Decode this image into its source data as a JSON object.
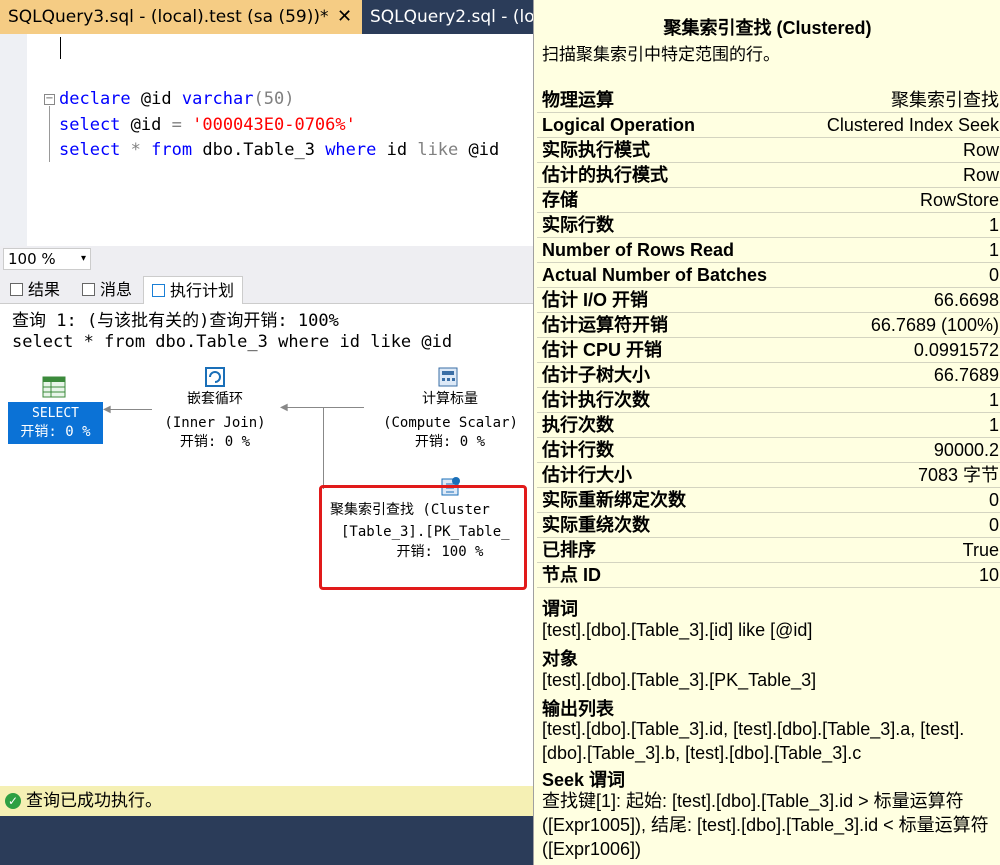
{
  "tabs": {
    "active": "SQLQuery3.sql - (local).test (sa (59))*",
    "active_close": "✕",
    "inactive": "SQLQuery2.sql - (lo"
  },
  "editor": {
    "fold_symbol": "−",
    "line1": {
      "kw1": "declare",
      "text1": " @id ",
      "kw2": "varchar",
      "text2": "(50)"
    },
    "line2": {
      "kw1": "select",
      "text1": " @id ",
      "op1": "=",
      "text2": " ",
      "str": "'000043E0-0706%'"
    },
    "line3": {
      "kw1": "select",
      "text1": " ",
      "op1": "*",
      "text2": " ",
      "kw2": "from",
      "text3": " dbo.Table_3 ",
      "kw3": "where",
      "text4": " id ",
      "op2": "like",
      "text5": " @id"
    }
  },
  "zoom": {
    "value": "100 %",
    "arrow": "▾"
  },
  "result_tabs": {
    "results": "结果",
    "messages": "消息",
    "plan": "执行计划"
  },
  "plan": {
    "query_header": "查询 1: (与该批有关的)查询开销: 100%",
    "query_sql": "select * from dbo.Table_3 where id like @id",
    "nodes": {
      "select": {
        "name": "SELECT",
        "cost": "开销: 0 %"
      },
      "nested_loops": {
        "name": "嵌套循环",
        "sub": "(Inner Join)",
        "cost": "开销: 0 %"
      },
      "compute_scalar": {
        "name": "计算标量",
        "sub": "(Compute Scalar)",
        "cost": "开销: 0 %"
      },
      "clustered_seek": {
        "name": "聚集索引查找 (Cluster",
        "sub": "[Table_3].[PK_Table_",
        "cost": "开销: 100 %"
      }
    }
  },
  "status": {
    "icon": "✓",
    "text": "查询已成功执行。"
  },
  "tooltip": {
    "title": "聚集索引查找 (Clustered)",
    "description": "扫描聚集索引中特定范围的行。",
    "rows": [
      {
        "k": "物理运算",
        "v": "聚集索引查找"
      },
      {
        "k": "Logical Operation",
        "v": "Clustered Index Seek"
      },
      {
        "k": "实际执行模式",
        "v": "Row"
      },
      {
        "k": "估计的执行模式",
        "v": "Row"
      },
      {
        "k": "存储",
        "v": "RowStore"
      },
      {
        "k": "实际行数",
        "v": "1"
      },
      {
        "k": "Number of Rows Read",
        "v": "1"
      },
      {
        "k": "Actual Number of Batches",
        "v": "0"
      },
      {
        "k": "估计 I/O 开销",
        "v": "66.6698"
      },
      {
        "k": "估计运算符开销",
        "v": "66.7689 (100%)"
      },
      {
        "k": "估计 CPU 开销",
        "v": "0.0991572"
      },
      {
        "k": "估计子树大小",
        "v": "66.7689"
      },
      {
        "k": "估计执行次数",
        "v": "1"
      },
      {
        "k": "执行次数",
        "v": "1"
      },
      {
        "k": "估计行数",
        "v": "90000.2"
      },
      {
        "k": "估计行大小",
        "v": "7083 字节"
      },
      {
        "k": "实际重新绑定次数",
        "v": "0"
      },
      {
        "k": "实际重绕次数",
        "v": "0"
      },
      {
        "k": "已排序",
        "v": "True"
      },
      {
        "k": "节点 ID",
        "v": "10"
      }
    ],
    "predicate_h": "谓词",
    "predicate_v": "[test].[dbo].[Table_3].[id] like [@id]",
    "object_h": "对象",
    "object_v": "[test].[dbo].[Table_3].[PK_Table_3]",
    "output_h": "输出列表",
    "output_v": "[test].[dbo].[Table_3].id, [test].[dbo].[Table_3].a, [test].[dbo].[Table_3].b, [test].[dbo].[Table_3].c",
    "seek_h": "Seek 谓词",
    "seek_v": "查找键[1]: 起始: [test].[dbo].[Table_3].id  > 标量运算符([Expr1005]), 结尾: [test].[dbo].[Table_3].id  < 标量运算符([Expr1006])"
  }
}
